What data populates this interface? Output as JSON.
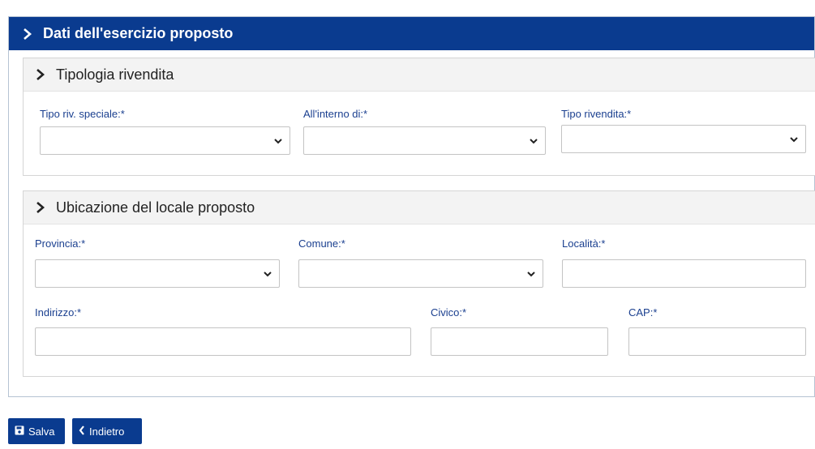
{
  "panel": {
    "title": "Dati dell'esercizio proposto"
  },
  "sections": {
    "tipologia": {
      "title": "Tipologia rivendita",
      "fields": {
        "tipo_riv_speciale": {
          "label": "Tipo riv. speciale:*",
          "value": ""
        },
        "all_interno_di": {
          "label": "All'interno di:*",
          "value": ""
        },
        "tipo_rivendita": {
          "label": "Tipo rivendita:*",
          "value": ""
        }
      }
    },
    "ubicazione": {
      "title": "Ubicazione del locale proposto",
      "fields": {
        "provincia": {
          "label": "Provincia:*",
          "value": ""
        },
        "comune": {
          "label": "Comune:*",
          "value": ""
        },
        "localita": {
          "label": "Località:*",
          "value": ""
        },
        "indirizzo": {
          "label": "Indirizzo:*",
          "value": ""
        },
        "civico": {
          "label": "Civico:*",
          "value": ""
        },
        "cap": {
          "label": "CAP:*",
          "value": ""
        }
      }
    }
  },
  "buttons": {
    "salva": {
      "label": "Salva",
      "icon": "save-icon"
    },
    "indietro": {
      "label": "Indietro",
      "icon": "chevron-left-icon"
    }
  },
  "colors": {
    "primary": "#0a3b8f",
    "label": "#1a3f8f"
  }
}
